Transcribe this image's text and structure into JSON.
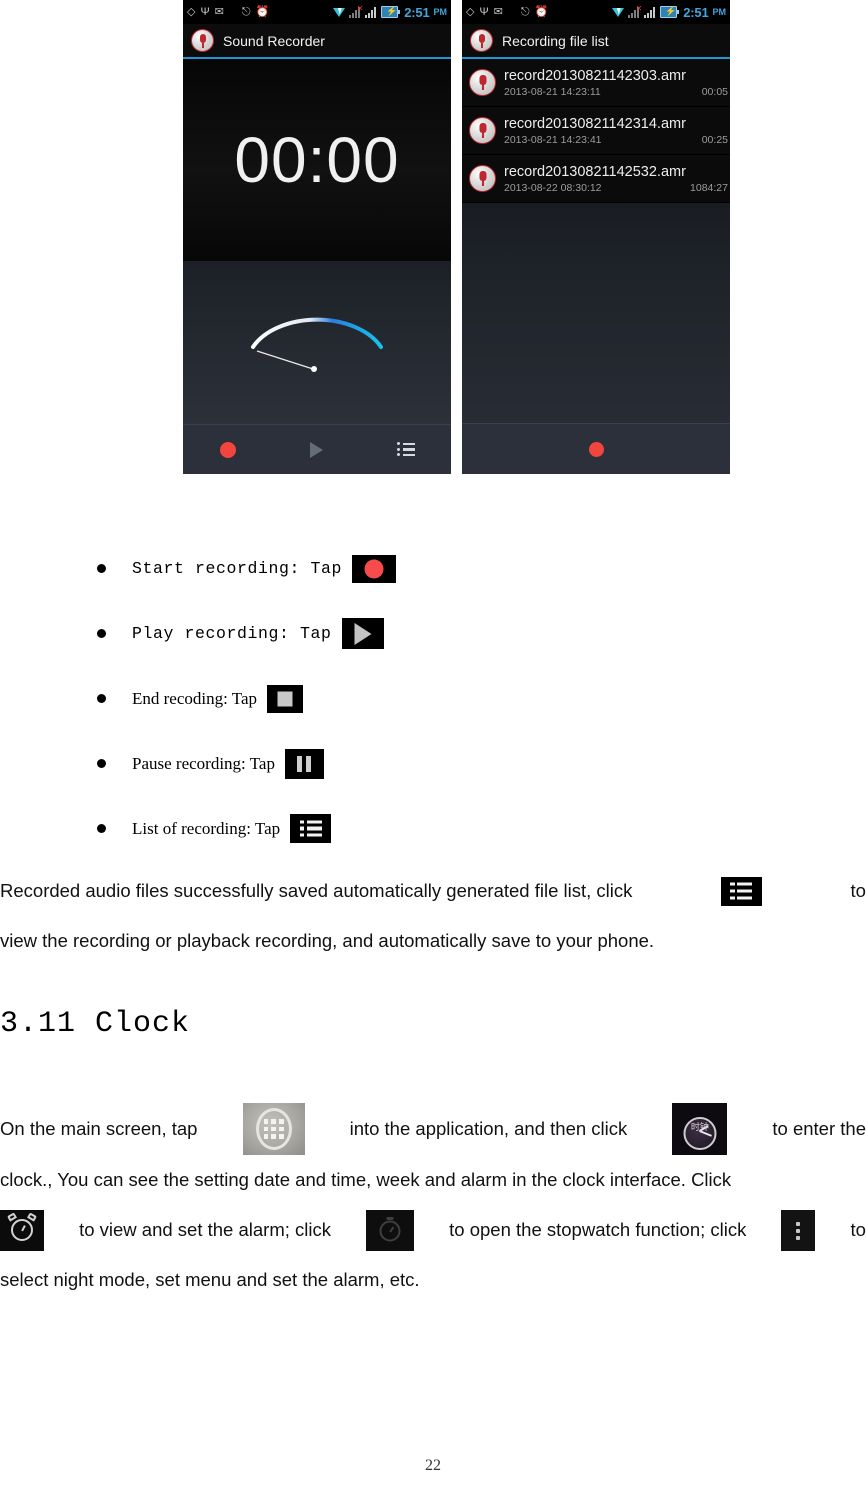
{
  "screenshots": {
    "left_phone": {
      "statusbar": {
        "icons": [
          "gps-icon",
          "usb-icon",
          "gmail-icon",
          "bluetooth-icon",
          "headset-icon",
          "alarm-icon",
          "wifi-icon",
          "signal-icon-1",
          "signal-icon-2",
          "battery-icon"
        ],
        "time": "2:51",
        "ampm": "PM",
        "time_color": "#3fa7dd"
      },
      "title": "Sound Recorder",
      "timer": "00:00",
      "accent_color": "#2196d6",
      "record_color": "#f2453d",
      "controls": [
        "record-button",
        "play-button",
        "list-button"
      ]
    },
    "right_phone": {
      "statusbar": {
        "time": "2:51",
        "ampm": "PM"
      },
      "title": "Recording file list",
      "files": [
        {
          "name": "record20130821142303.amr",
          "date": "2013-08-21 14:23:11",
          "duration": "00:05"
        },
        {
          "name": "record20130821142314.amr",
          "date": "2013-08-21 14:23:41",
          "duration": "00:25"
        },
        {
          "name": "record20130821142532.amr",
          "date": "2013-08-22 08:30:12",
          "duration": "1084:27"
        }
      ],
      "controls": [
        "record-button"
      ]
    }
  },
  "bullets": [
    {
      "label": "Start recording: Tap",
      "icon": "record-icon",
      "mono": true
    },
    {
      "label": "Play recording: Tap",
      "icon": "play-icon",
      "mono": true
    },
    {
      "label": "End recoding: Tap",
      "icon": "stop-icon",
      "mono": false
    },
    {
      "label": "Pause recording: Tap",
      "icon": "pause-icon",
      "mono": false
    },
    {
      "label": "List of recording: Tap",
      "icon": "list-icon",
      "mono": false
    }
  ],
  "paragraph_saved": {
    "line1_a": "Recorded  audio  files  successfully  saved  automatically  generated  file  list,  click",
    "line1_b": "to",
    "line2": "view the recording or playback recording, and automatically save to your phone."
  },
  "heading": "3.11 Clock",
  "paragraph_clock": {
    "line1_a": "On the main screen, tap",
    "line1_b": "into the application, and then click",
    "line1_c": "to enter the",
    "line2": "clock., You can see the setting date and time, week and alarm in the clock interface. Click",
    "line3_a": "to view and set the alarm; click",
    "line3_b": "to open the stopwatch function; click",
    "line3_c": "to",
    "line4": "select night mode, set menu and set the alarm, etc.",
    "clock_icon_caption": "时钟"
  },
  "page_number": "22"
}
